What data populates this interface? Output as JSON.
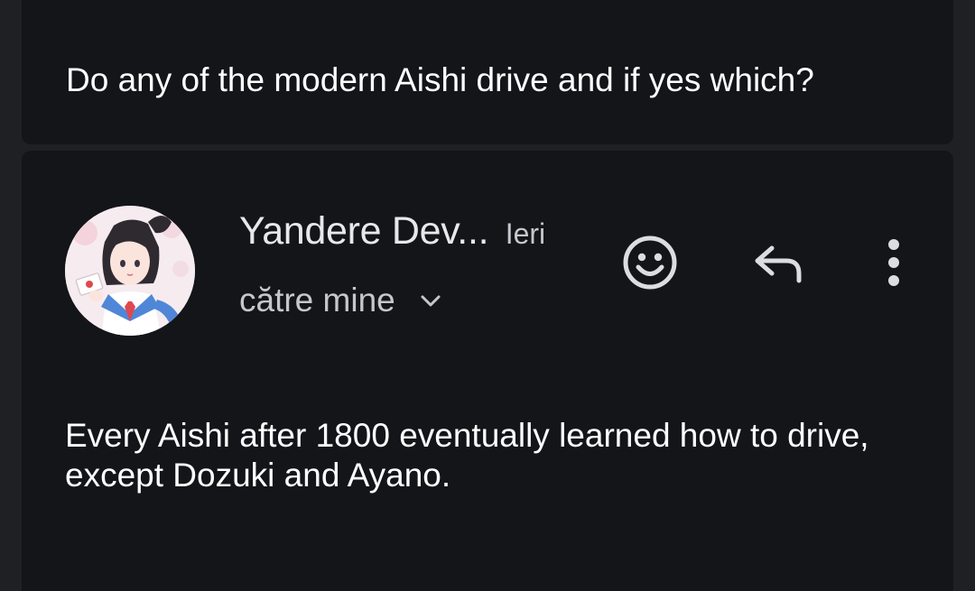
{
  "previous_message": {
    "body": "Do any of the modern Aishi drive and if yes which?"
  },
  "message": {
    "sender_name": "Yandere Dev...",
    "time": "Ieri",
    "recipient": "către mine",
    "body": "Every Aishi after 1800 eventually learned how to drive, except Dozuki and Ayano.",
    "actions": {
      "react_icon": "emoji-add-icon",
      "reply_icon": "reply-icon",
      "more_icon": "more-vert-icon"
    }
  },
  "colors": {
    "background": "#1f2024",
    "card": "#141519",
    "text_primary": "#ffffff",
    "text_secondary": "#c6c7cc"
  }
}
